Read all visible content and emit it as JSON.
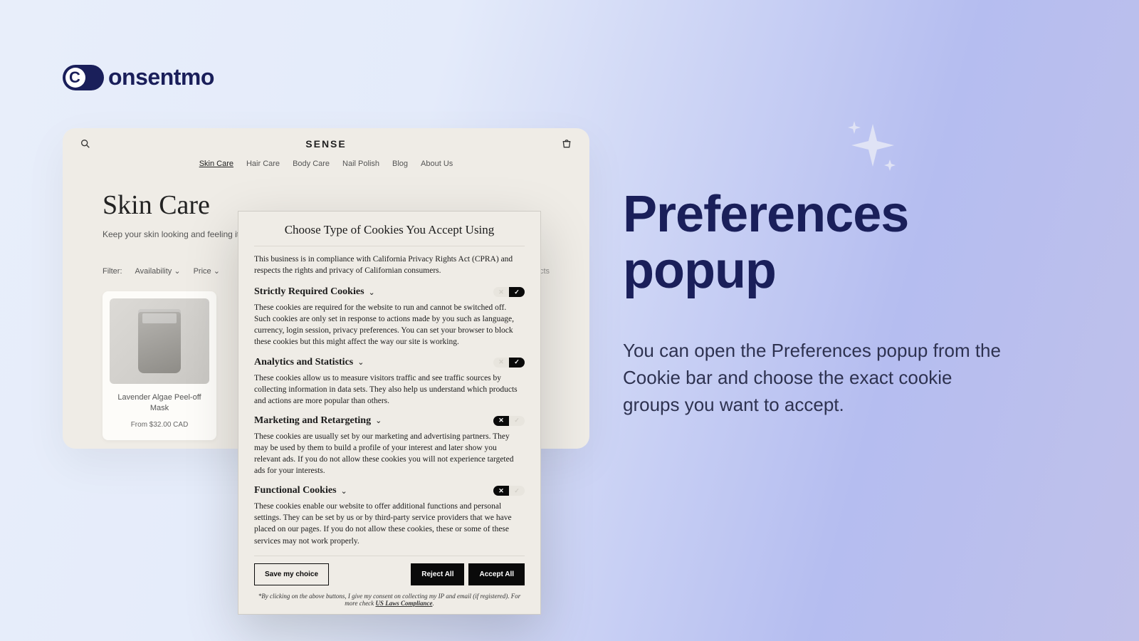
{
  "brand": {
    "name": "onsentmo"
  },
  "info": {
    "title": "Preferences popup",
    "body": "You can open the Preferences popup from the Cookie bar and choose the exact cookie groups you want to accept."
  },
  "store": {
    "brand": "SENSE",
    "nav": {
      "items": [
        "Skin Care",
        "Hair Care",
        "Body Care",
        "Nail Polish",
        "Blog",
        "About Us"
      ],
      "active": "Skin Care"
    },
    "heading": "Skin Care",
    "sub": "Keep your skin looking and feeling its",
    "filter_label": "Filter:",
    "filters": [
      "Availability",
      "Price"
    ],
    "trailing_text": "ducts",
    "products": [
      {
        "name": "Lavender Algae Peel-off Mask",
        "price": "From $32.00 CAD"
      }
    ]
  },
  "cookie": {
    "title": "Choose Type of Cookies You Accept Using",
    "compliance": "This business is in compliance with California Privacy Rights Act (CPRA) and respects the rights and privacy of Californian consumers.",
    "categories": [
      {
        "title": "Strictly Required Cookies",
        "state": "on",
        "desc": "These cookies are required for the website to run and cannot be switched off. Such cookies are only set in response to actions made by you such as language, currency, login session, privacy preferences. You can set your browser to block these cookies but this might affect the way our site is working."
      },
      {
        "title": "Analytics and Statistics",
        "state": "on",
        "desc": "These cookies allow us to measure visitors traffic and see traffic sources by collecting information in data sets. They also help us understand which products and actions are more popular than others."
      },
      {
        "title": "Marketing and Retargeting",
        "state": "off",
        "desc": "These cookies are usually set by our marketing and advertising partners. They may be used by them to build a profile of your interest and later show you relevant ads. If you do not allow these cookies you will not experience targeted ads for your interests."
      },
      {
        "title": "Functional Cookies",
        "state": "off",
        "desc": "These cookies enable our website to offer additional functions and personal settings. They can be set by us or by third-party service providers that we have placed on our pages. If you do not allow these cookies, these or some of these services may not work properly."
      }
    ],
    "buttons": {
      "save": "Save my choice",
      "reject": "Reject All",
      "accept": "Accept All"
    },
    "footnote_pre": "*By clicking on the above buttons, I give my consent on collecting my IP and email (if registered). For more check ",
    "footnote_link": "US Laws Compliance",
    "footnote_post": "."
  }
}
